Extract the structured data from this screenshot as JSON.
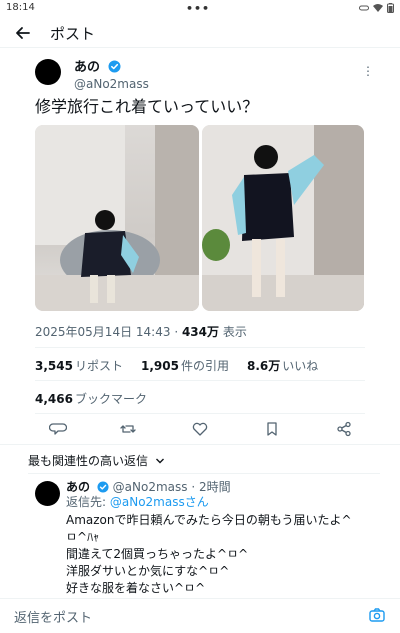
{
  "status_bar": {
    "time": "18:14"
  },
  "header": {
    "title": "ポスト"
  },
  "post": {
    "author_name": "あの",
    "author_handle": "@aNo2mass",
    "text": "修学旅行これ着ていっていい？",
    "timestamp": "2025年05月14日 14:43",
    "views_count": "434万",
    "views_label": "表示",
    "reposts_count": "3,545",
    "reposts_label": "リポスト",
    "quotes_count": "1,905",
    "quotes_label": "件の引用",
    "likes_count": "8.6万",
    "likes_label": "いいね",
    "bookmarks_count": "4,466",
    "bookmarks_label": "ブックマーク"
  },
  "replies": {
    "sort_label": "最も関連性の高い返信",
    "items": [
      {
        "author_name": "あの",
        "author_handle": "@aNo2mass",
        "time": "2時間",
        "reply_to_label": "返信先:",
        "reply_to_handle": "@aNo2massさん",
        "lines": [
          "Amazonで昨日頼んでみたら今日の朝もう届いたよ^",
          "ㅁ^ﾊｬ",
          "間違えて2個買っちゃったよ^ㅁ^",
          "洋服ダサいとか気にすな^ㅁ^",
          "好きな服を着なさい^ㅁ^"
        ]
      }
    ]
  },
  "composer": {
    "placeholder": "返信をポスト"
  },
  "colors": {
    "accent": "#1d9bf0",
    "text": "#0f1419",
    "muted": "#536471"
  }
}
